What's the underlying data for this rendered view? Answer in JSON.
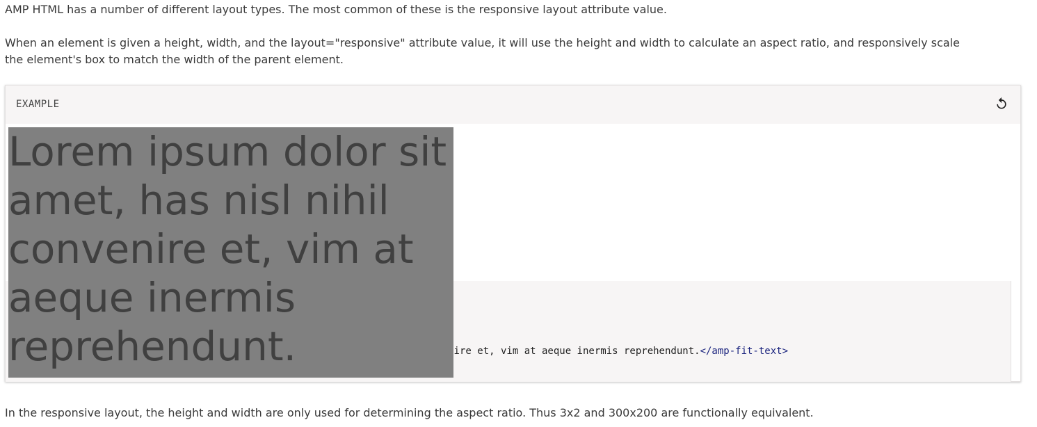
{
  "paragraphs": {
    "intro": "AMP HTML has a number of different layout types. The most common of these is the responsive layout attribute value.",
    "responsive": "When an element is given a height, width, and the layout=\"responsive\" attribute value, it will use the height and width to calculate an aspect ratio, and responsively scale the element's box to match the width of the parent element.",
    "aspect": "In the responsive layout, the height and width are only used for determining the aspect ratio. Thus 3x2 and 300x200 are functionally equivalent."
  },
  "example": {
    "label": "EXAMPLE",
    "reload_icon": "reload-icon",
    "fit_text": "Lorem ipsum dolor sit amet, has nisl nihil convenire et, vim at aeque inermis reprehendunt.",
    "code_visible_text": "nire et, vim at aeque inermis reprehendunt.",
    "code_closing_tag": "</amp-fit-text>"
  },
  "colors": {
    "header_bg": "#f7f5f5",
    "fit_box_bg": "#808080",
    "fit_text": "#404040",
    "code_tag": "#1a237e"
  }
}
